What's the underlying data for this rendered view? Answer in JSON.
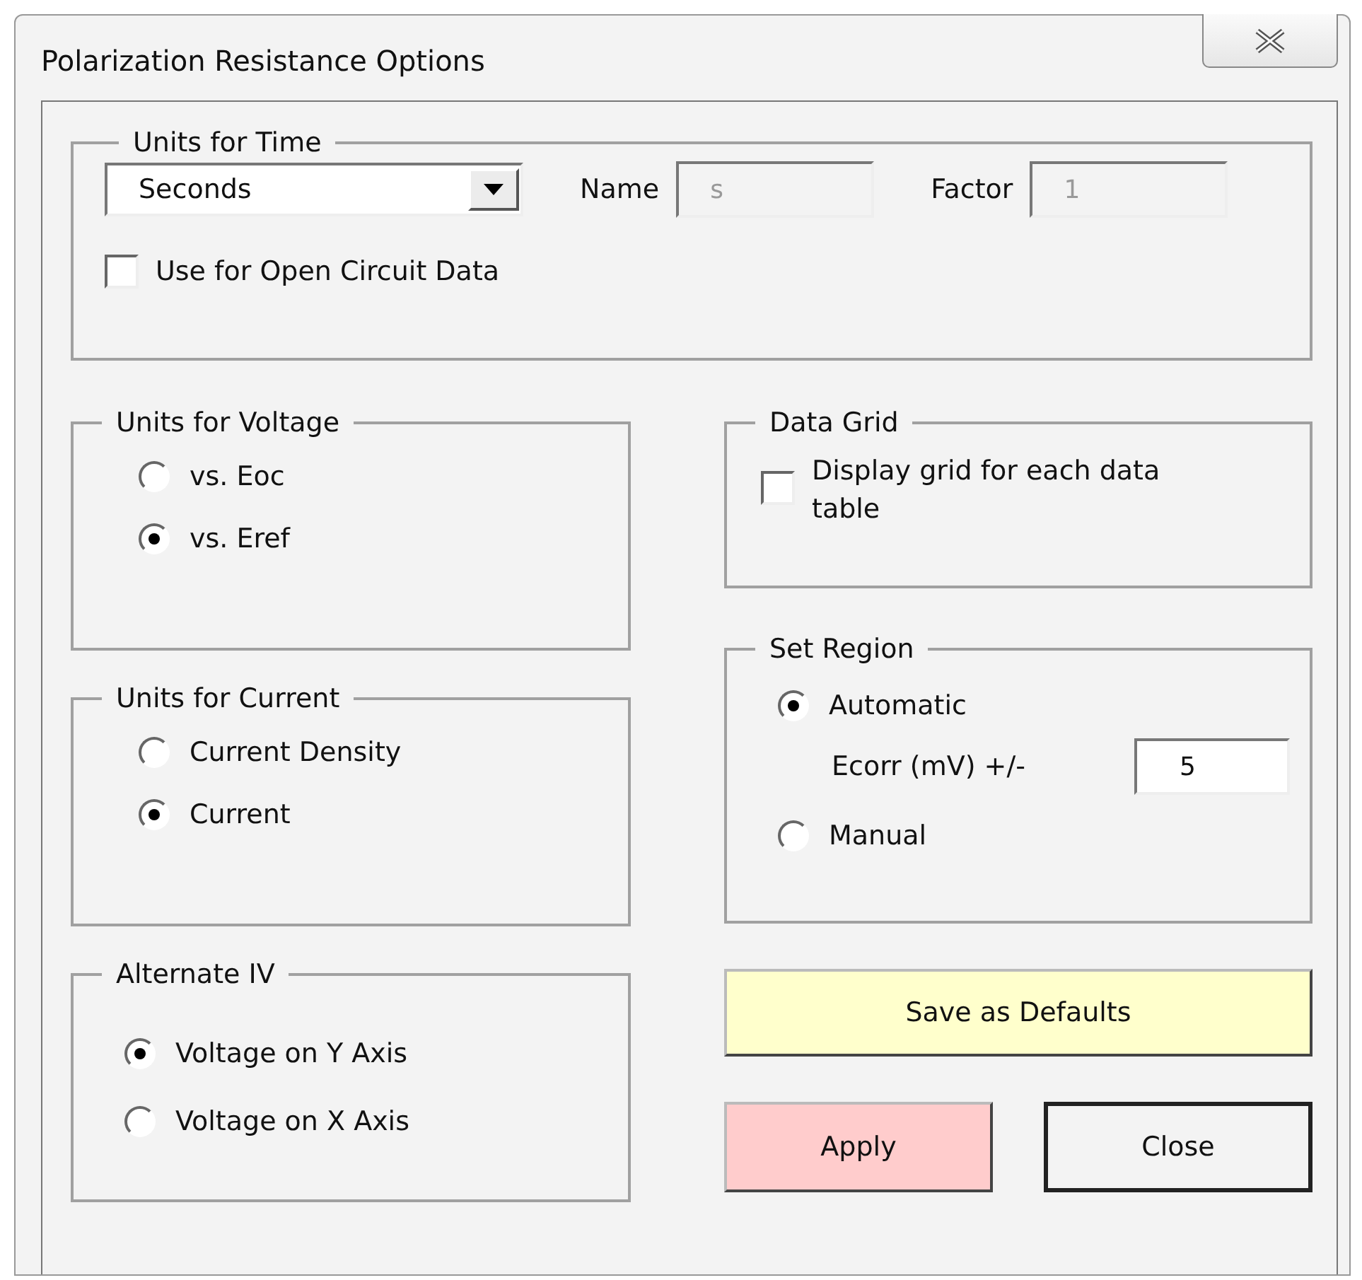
{
  "window": {
    "title": "Polarization Resistance Options"
  },
  "time_units": {
    "title": "Units for Time",
    "dropdown": "Seconds",
    "name_label": "Name",
    "name_value": "s",
    "name_disabled": true,
    "factor_label": "Factor",
    "factor_value": "1",
    "factor_disabled": true,
    "checkbox": {
      "label": "Use for Open Circuit Data",
      "checked": false
    }
  },
  "voltage_units": {
    "title": "Units for Voltage",
    "options": [
      {
        "label": "vs. Eoc",
        "selected": false
      },
      {
        "label": "vs. Eref",
        "selected": true
      }
    ]
  },
  "current_units": {
    "title": "Units for Current",
    "options": [
      {
        "label": "Current Density",
        "selected": false
      },
      {
        "label": "Current",
        "selected": true
      }
    ]
  },
  "alternate_iv": {
    "title": "Alternate IV",
    "options": [
      {
        "label": "Voltage on Y Axis",
        "selected": true
      },
      {
        "label": "Voltage on X Axis",
        "selected": false
      }
    ]
  },
  "data_grid": {
    "title": "Data Grid",
    "checkbox": {
      "label": "Display grid for each data table",
      "checked": false
    }
  },
  "set_region": {
    "title": "Set Region",
    "options": [
      {
        "label": "Automatic",
        "selected": true
      },
      {
        "label": "Manual",
        "selected": false
      }
    ],
    "ecorr_label": "Ecorr (mV) +/-",
    "ecorr_value": "5"
  },
  "buttons": [
    {
      "label": "Save as Defaults",
      "kind": "defaults"
    },
    {
      "label": "Apply",
      "kind": "apply"
    },
    {
      "label": "Close",
      "kind": "close"
    }
  ]
}
